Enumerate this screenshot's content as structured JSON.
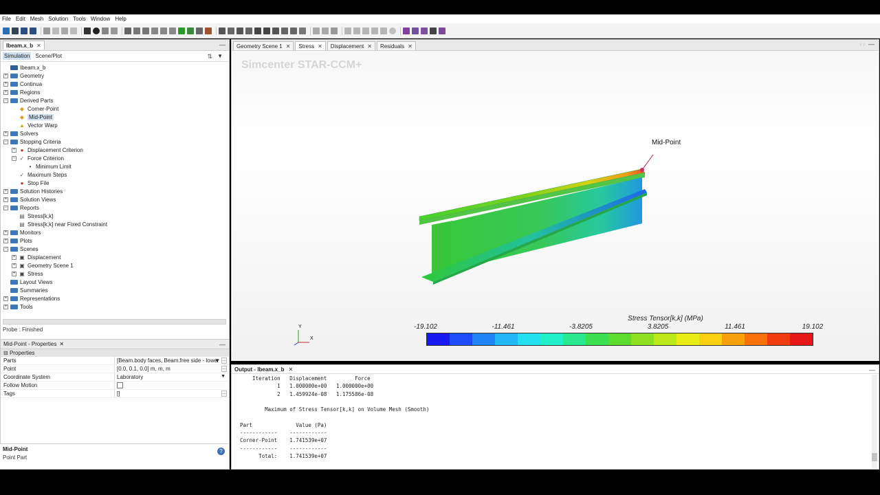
{
  "menu": [
    "File",
    "Edit",
    "Mesh",
    "Solution",
    "Tools",
    "Window",
    "Help"
  ],
  "left_tab": {
    "title": "Ibeam.x_b",
    "close": "✕",
    "minimize": "—"
  },
  "subtabs": {
    "simulation": "Simulation",
    "sceneplot": "Scene/Plot"
  },
  "tree": [
    {
      "label": "Ibeam.x_b",
      "level": 0,
      "exp": "",
      "icon": "sim"
    },
    {
      "label": "Geometry",
      "level": 0,
      "exp": "+",
      "icon": "folder"
    },
    {
      "label": "Continua",
      "level": 0,
      "exp": "+",
      "icon": "folder"
    },
    {
      "label": "Regions",
      "level": 0,
      "exp": "+",
      "icon": "folder"
    },
    {
      "label": "Derived Parts",
      "level": 0,
      "exp": "−",
      "icon": "folder"
    },
    {
      "label": "Corner-Point",
      "level": 1,
      "exp": "",
      "icon": "part"
    },
    {
      "label": "Mid-Point",
      "level": 1,
      "exp": "",
      "icon": "part",
      "selected": true
    },
    {
      "label": "Vector Warp",
      "level": 1,
      "exp": "",
      "icon": "warp"
    },
    {
      "label": "Solvers",
      "level": 0,
      "exp": "+",
      "icon": "folder"
    },
    {
      "label": "Stopping Criteria",
      "level": 0,
      "exp": "−",
      "icon": "folder"
    },
    {
      "label": "Displacement Criterion",
      "level": 1,
      "exp": "+",
      "icon": "stop"
    },
    {
      "label": "Force Criterion",
      "level": 1,
      "exp": "−",
      "icon": "crit"
    },
    {
      "label": "Minimum Limit",
      "level": 2,
      "exp": "",
      "icon": "dot"
    },
    {
      "label": "Maximum Steps",
      "level": 1,
      "exp": "",
      "icon": "crit"
    },
    {
      "label": "Stop File",
      "level": 1,
      "exp": "",
      "icon": "stop"
    },
    {
      "label": "Solution Histories",
      "level": 0,
      "exp": "+",
      "icon": "folder"
    },
    {
      "label": "Solution Views",
      "level": 0,
      "exp": "+",
      "icon": "folder"
    },
    {
      "label": "Reports",
      "level": 0,
      "exp": "−",
      "icon": "folder"
    },
    {
      "label": "Stress[k,k]",
      "level": 1,
      "exp": "",
      "icon": "report"
    },
    {
      "label": "Stress[k,k] near Fixed Constraint",
      "level": 1,
      "exp": "",
      "icon": "report"
    },
    {
      "label": "Monitors",
      "level": 0,
      "exp": "+",
      "icon": "folder"
    },
    {
      "label": "Plots",
      "level": 0,
      "exp": "+",
      "icon": "folder"
    },
    {
      "label": "Scenes",
      "level": 0,
      "exp": "−",
      "icon": "folder"
    },
    {
      "label": "Displacement",
      "level": 1,
      "exp": "+",
      "icon": "scene"
    },
    {
      "label": "Geometry Scene 1",
      "level": 1,
      "exp": "+",
      "icon": "scene"
    },
    {
      "label": "Stress",
      "level": 1,
      "exp": "+",
      "icon": "scene"
    },
    {
      "label": "Layout Views",
      "level": 0,
      "exp": "",
      "icon": "folder"
    },
    {
      "label": "Summaries",
      "level": 0,
      "exp": "",
      "icon": "folder"
    },
    {
      "label": "Representations",
      "level": 0,
      "exp": "+",
      "icon": "folder"
    },
    {
      "label": "Tools",
      "level": 0,
      "exp": "+",
      "icon": "folder"
    }
  ],
  "status": "Probe : Finished",
  "props": {
    "title": "Mid-Point - Properties",
    "section": "Properties",
    "rows": [
      {
        "key": "Parts",
        "value": "[Beam.body faces, Beam.free side - lower"
      },
      {
        "key": "Point",
        "value": "[0.0, 0.1, 0.0] m, m, m"
      },
      {
        "key": "Coordinate System",
        "value": "Laboratory"
      },
      {
        "key": "Follow Motion",
        "value": ""
      },
      {
        "key": "Tags",
        "value": "[]"
      }
    ],
    "footer_title": "Mid-Point",
    "footer_sub": "Point Part"
  },
  "viewer": {
    "tabs": [
      "Geometry Scene 1",
      "Stress",
      "Displacement",
      "Residuals"
    ],
    "watermark": "Simcenter STAR-CCM+",
    "callout": "Mid-Point",
    "legend_title": "Stress Tensor[k,k] (MPa)",
    "ticks": [
      "-19.102",
      "-11.461",
      "-3.8205",
      "3.8205",
      "11.461",
      "19.102"
    ],
    "axis_y": "Y",
    "axis_x": "X",
    "colors": [
      "#1818f0",
      "#1c4cf8",
      "#1e84f8",
      "#22b8f8",
      "#22e0f0",
      "#20f0c8",
      "#28e890",
      "#3ae050",
      "#5cdc2c",
      "#8ce020",
      "#bce818",
      "#e6ec14",
      "#f8d010",
      "#f8a00c",
      "#f87008",
      "#f03c0c",
      "#e81818"
    ]
  },
  "output": {
    "title": "Output - Ibeam.x_b",
    "lines": [
      "    Iteration   Displacement         Force",
      "            1   1.000000e+00   1.000000e+00",
      "            2   1.459924e-08   1.175586e-08",
      "",
      "        Maximum of Stress Tensor[k,k] on Volume Mesh (Smooth)",
      "",
      "Part              Value (Pa)",
      "------------    ------------",
      "Corner-Point    1.741539e+07",
      "------------    ------------",
      "      Total:    1.741539e+07"
    ]
  }
}
